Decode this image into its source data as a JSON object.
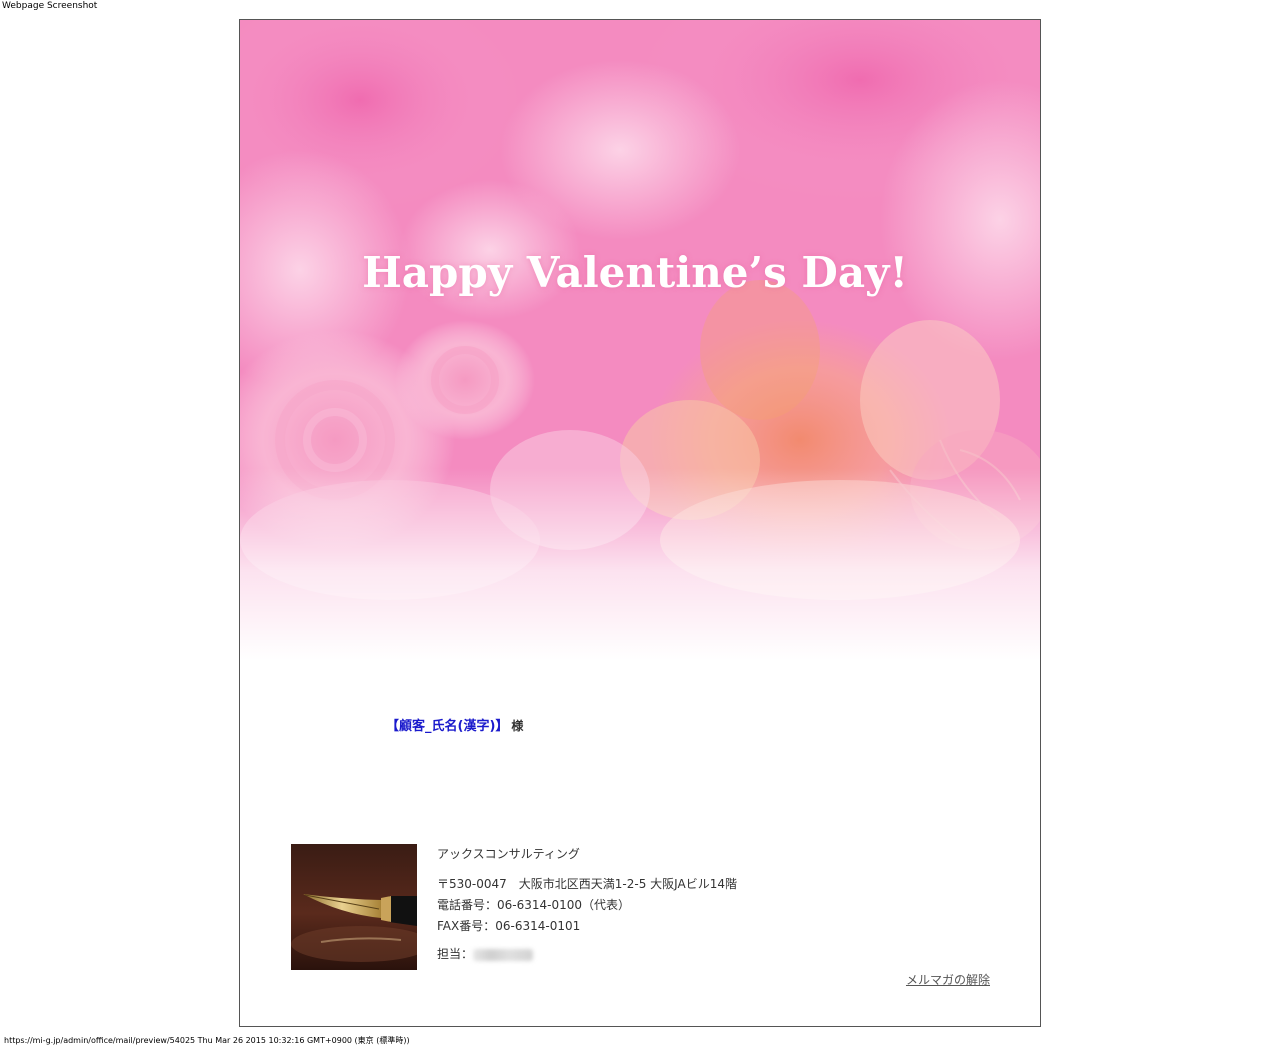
{
  "screenshot_label": "Webpage Screenshot",
  "hero": {
    "title": "Happy Valentine’s Day!"
  },
  "greeting": {
    "customer_placeholder": "【顧客_氏名(漢字)】",
    "honorific": "様"
  },
  "company": {
    "name": "アックスコンサルティング",
    "address": "〒530-0047　大阪市北区西天満1-2-5 大阪JAビル14階",
    "phone": "電話番号：06-6314-0100（代表）",
    "fax": "FAX番号：06-6314-0101",
    "staff_label": "担当："
  },
  "footer": {
    "unsubscribe_label": "メルマガの解除"
  },
  "status_bar": {
    "text": "https://mi-g.jp/admin/office/mail/preview/54025 Thu Mar 26 2015 10:32:16 GMT+0900 (東京 (標準時))"
  },
  "colors": {
    "customer_link": "#1a1acc",
    "hero_pink": "#f07ab8"
  },
  "icons": {
    "pen_photo": "fountain-pen-photo"
  }
}
